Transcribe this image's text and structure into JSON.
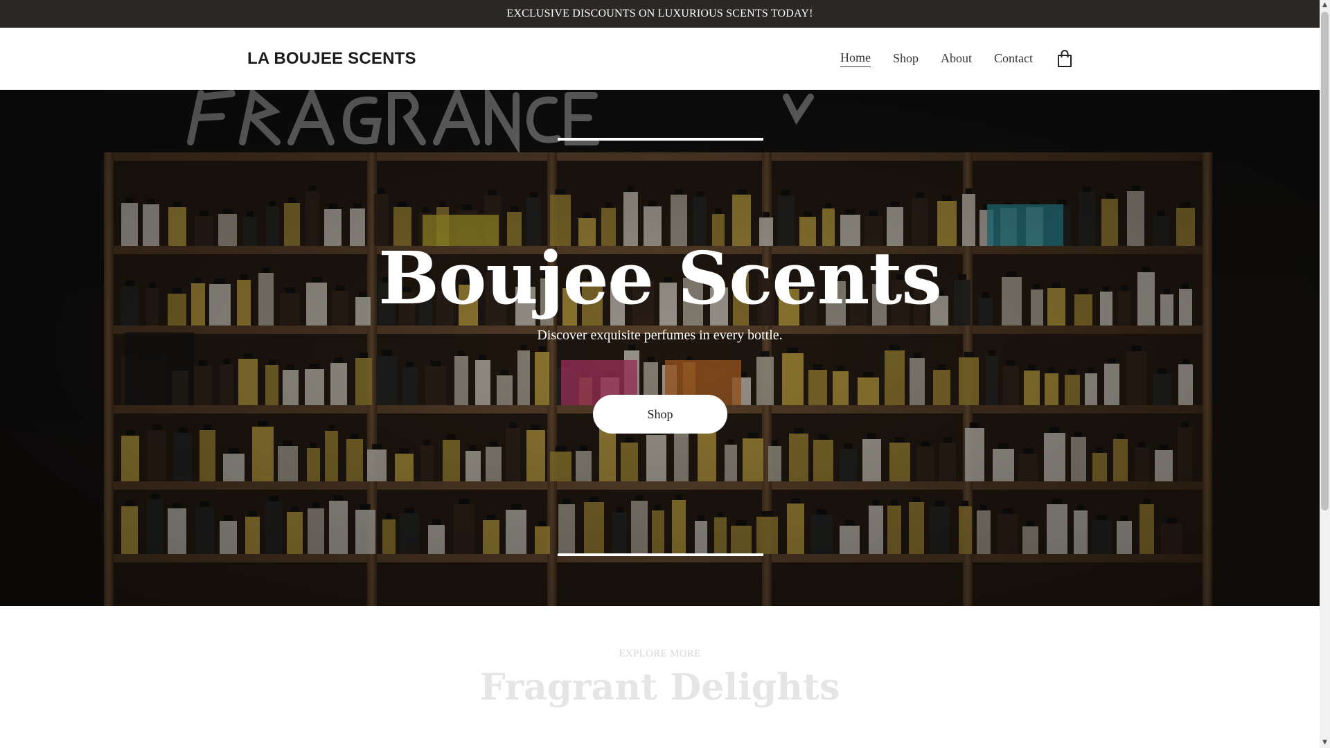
{
  "announcement": {
    "text": "EXCLUSIVE DISCOUNTS ON LUXURIOUS SCENTS TODAY!"
  },
  "header": {
    "logo": "LA BOUJEE SCENTS",
    "nav": [
      {
        "label": "Home",
        "active": true
      },
      {
        "label": "Shop",
        "active": false
      },
      {
        "label": "About",
        "active": false
      },
      {
        "label": "Contact",
        "active": false
      }
    ],
    "cart_icon": "shopping-bag-icon"
  },
  "hero": {
    "title": "Boujee Scents",
    "subtitle": "Discover exquisite perfumes in every bottle.",
    "button_label": "Shop",
    "background_description_color": "#2a1f16"
  },
  "section": {
    "eyebrow": "EXPLORE MORE",
    "title": "Fragrant Delights"
  },
  "colors": {
    "announcement_bg": "#2b2927",
    "text_dark": "#1b1b1b",
    "hero_overlay": "#000000",
    "button_bg": "#ffffff"
  }
}
